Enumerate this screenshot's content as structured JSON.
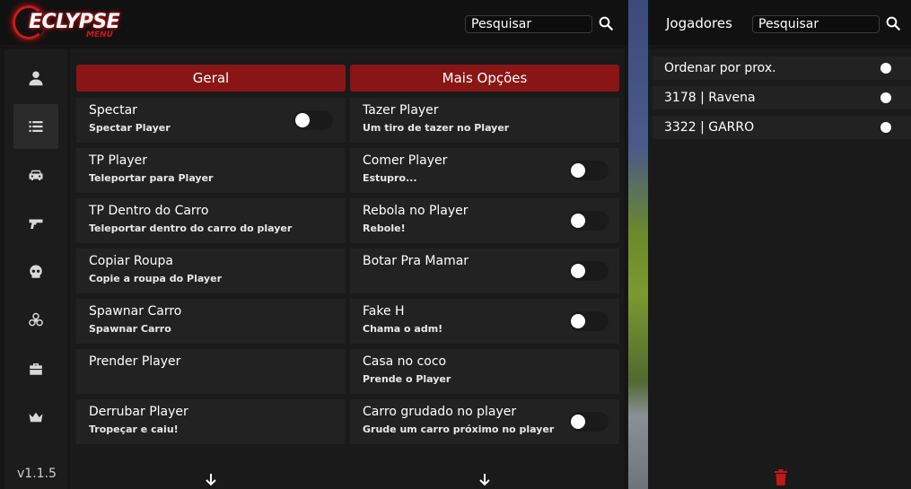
{
  "app": {
    "logo_text": "ECLYPSE",
    "logo_sub": "MENU",
    "version": "v1.1.5",
    "accent_color": "#8a1515"
  },
  "search": {
    "main_placeholder": "Pesquisar",
    "players_placeholder": "Pesquisar"
  },
  "sidebar": {
    "items": [
      {
        "icon": "user-icon"
      },
      {
        "icon": "list-icon",
        "active": true
      },
      {
        "icon": "car-icon"
      },
      {
        "icon": "gun-icon"
      },
      {
        "icon": "skull-icon"
      },
      {
        "icon": "biohazard-icon"
      },
      {
        "icon": "toolbox-icon"
      },
      {
        "icon": "crown-icon"
      }
    ]
  },
  "tabs": {
    "left": "Geral",
    "right": "Mais Opções"
  },
  "left_options": [
    {
      "title": "Spectar",
      "sub": "Spectar Player",
      "toggle": true,
      "on": false
    },
    {
      "title": "TP Player",
      "sub": "Teleportar para Player",
      "toggle": false
    },
    {
      "title": "TP Dentro do Carro",
      "sub": "Teleportar dentro do carro do player",
      "toggle": false
    },
    {
      "title": "Copiar Roupa",
      "sub": "Copie a roupa do Player",
      "toggle": false
    },
    {
      "title": "Spawnar Carro",
      "sub": "Spawnar Carro",
      "toggle": false
    },
    {
      "title": "Prender Player",
      "sub": "",
      "toggle": false
    },
    {
      "title": "Derrubar Player",
      "sub": "Tropeçar e caiu!",
      "toggle": false
    }
  ],
  "right_options": [
    {
      "title": "Tazer Player",
      "sub": "Um tiro de tazer no Player",
      "toggle": false
    },
    {
      "title": "Comer Player",
      "sub": "Estupro...",
      "toggle": true,
      "on": false
    },
    {
      "title": "Rebola no Player",
      "sub": "Rebole!",
      "toggle": true,
      "on": false
    },
    {
      "title": "Botar Pra Mamar",
      "sub": "",
      "toggle": true,
      "on": false
    },
    {
      "title": "Fake H",
      "sub": "Chama o adm!",
      "toggle": true,
      "on": false
    },
    {
      "title": "Casa no coco",
      "sub": "Prende o Player",
      "toggle": false
    },
    {
      "title": "Carro grudado no player",
      "sub": "Grude um carro próximo no player",
      "toggle": true,
      "on": false
    }
  ],
  "players": {
    "title": "Jogadores",
    "rows": [
      {
        "label": "Ordenar por prox."
      },
      {
        "label": "3178 | Ravena"
      },
      {
        "label": "3322 | GARRO"
      }
    ],
    "trash_color": "#c01818"
  }
}
